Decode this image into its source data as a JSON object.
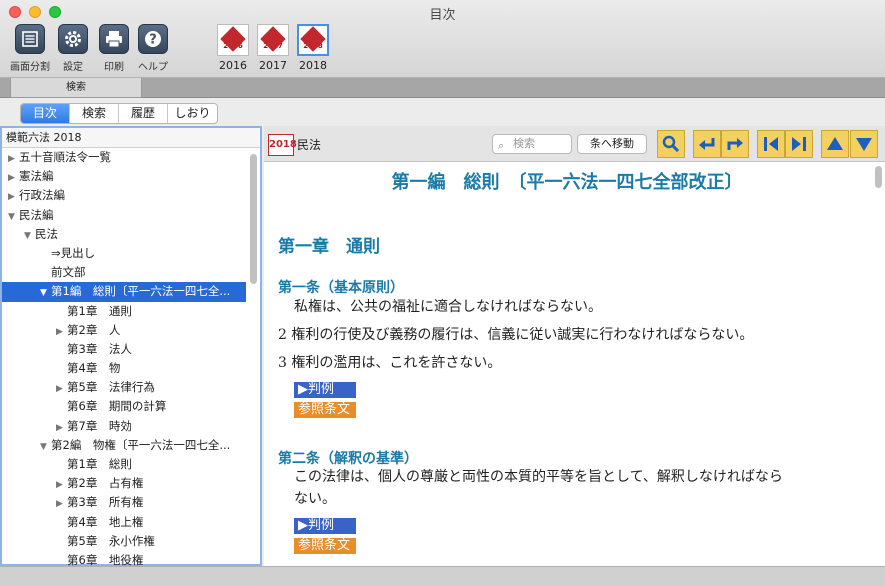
{
  "window": {
    "title": "目次"
  },
  "toolbar": {
    "tools": [
      {
        "name": "split-view",
        "label": "画面分割"
      },
      {
        "name": "settings",
        "label": "設定"
      },
      {
        "name": "print",
        "label": "印刷"
      },
      {
        "name": "help",
        "label": "ヘルプ"
      }
    ],
    "books": [
      {
        "cover_text": "2016",
        "label": "2016"
      },
      {
        "cover_text": "2017",
        "label": "2017"
      },
      {
        "cover_text": "2018",
        "label": "2018",
        "selected": true
      }
    ]
  },
  "search_tab": {
    "label": "検索"
  },
  "segments": [
    {
      "label": "目次",
      "active": true
    },
    {
      "label": "検索"
    },
    {
      "label": "履歴"
    },
    {
      "label": "しおり"
    }
  ],
  "sidebar": {
    "title": "模範六法 2018",
    "items": [
      {
        "label": "五十音順法令一覧",
        "level": 0,
        "arrow": "right"
      },
      {
        "label": "憲法編",
        "level": 0,
        "arrow": "right"
      },
      {
        "label": "行政法編",
        "level": 0,
        "arrow": "right"
      },
      {
        "label": "民法編",
        "level": 0,
        "arrow": "down"
      },
      {
        "label": "民法",
        "level": 1,
        "arrow": "down"
      },
      {
        "label": "⇒見出し",
        "level": 2,
        "arrow": ""
      },
      {
        "label": "前文部",
        "level": 2,
        "arrow": ""
      },
      {
        "label": "第1編　総則〔平一六法一四七全...",
        "level": 2,
        "arrow": "down",
        "selected": true
      },
      {
        "label": "第1章　通則",
        "level": 3,
        "arrow": ""
      },
      {
        "label": "第2章　人",
        "level": 3,
        "arrow": "right"
      },
      {
        "label": "第3章　法人",
        "level": 3,
        "arrow": ""
      },
      {
        "label": "第4章　物",
        "level": 3,
        "arrow": ""
      },
      {
        "label": "第5章　法律行為",
        "level": 3,
        "arrow": "right"
      },
      {
        "label": "第6章　期間の計算",
        "level": 3,
        "arrow": ""
      },
      {
        "label": "第7章　時効",
        "level": 3,
        "arrow": "right"
      },
      {
        "label": "第2編　物権〔平一六法一四七全...",
        "level": 2,
        "arrow": "down"
      },
      {
        "label": "第1章　総則",
        "level": 3,
        "arrow": ""
      },
      {
        "label": "第2章　占有権",
        "level": 3,
        "arrow": "right"
      },
      {
        "label": "第3章　所有権",
        "level": 3,
        "arrow": "right"
      },
      {
        "label": "第4章　地上権",
        "level": 3,
        "arrow": ""
      },
      {
        "label": "第5章　永小作権",
        "level": 3,
        "arrow": ""
      },
      {
        "label": "第6章　地役権",
        "level": 3,
        "arrow": ""
      }
    ]
  },
  "content": {
    "year_badge": "2018",
    "law_name": "民法",
    "search_placeholder": "検索",
    "goto_label": "条へ移動",
    "part_title": "第一編　総則　〔平一六法一四七全部改正〕",
    "chapter_title": "第一章　通則",
    "article1_title": "第一条（基本原則）",
    "article1_p1": "私権は、公共の福祉に適合しなければならない。",
    "article1_p2": "2 権利の行使及び義務の履行は、信義に従い誠実に行わなければならない。",
    "article1_p3": "3 権利の濫用は、これを許さない。",
    "case_label": "▶判例",
    "ref_label": "参照条文",
    "article2_title": "第二条（解釈の基準）",
    "article2_p1": "この法律は、個人の尊厳と両性の本質的平等を旨として、解釈しなければなら",
    "article2_p2": "ない。"
  },
  "colors": {
    "accent": "#2869d8",
    "heading": "#1a7ba8",
    "case_tag": "#3a63c9",
    "ref_tag": "#e98c2a",
    "nav_button": "#f4d060"
  }
}
